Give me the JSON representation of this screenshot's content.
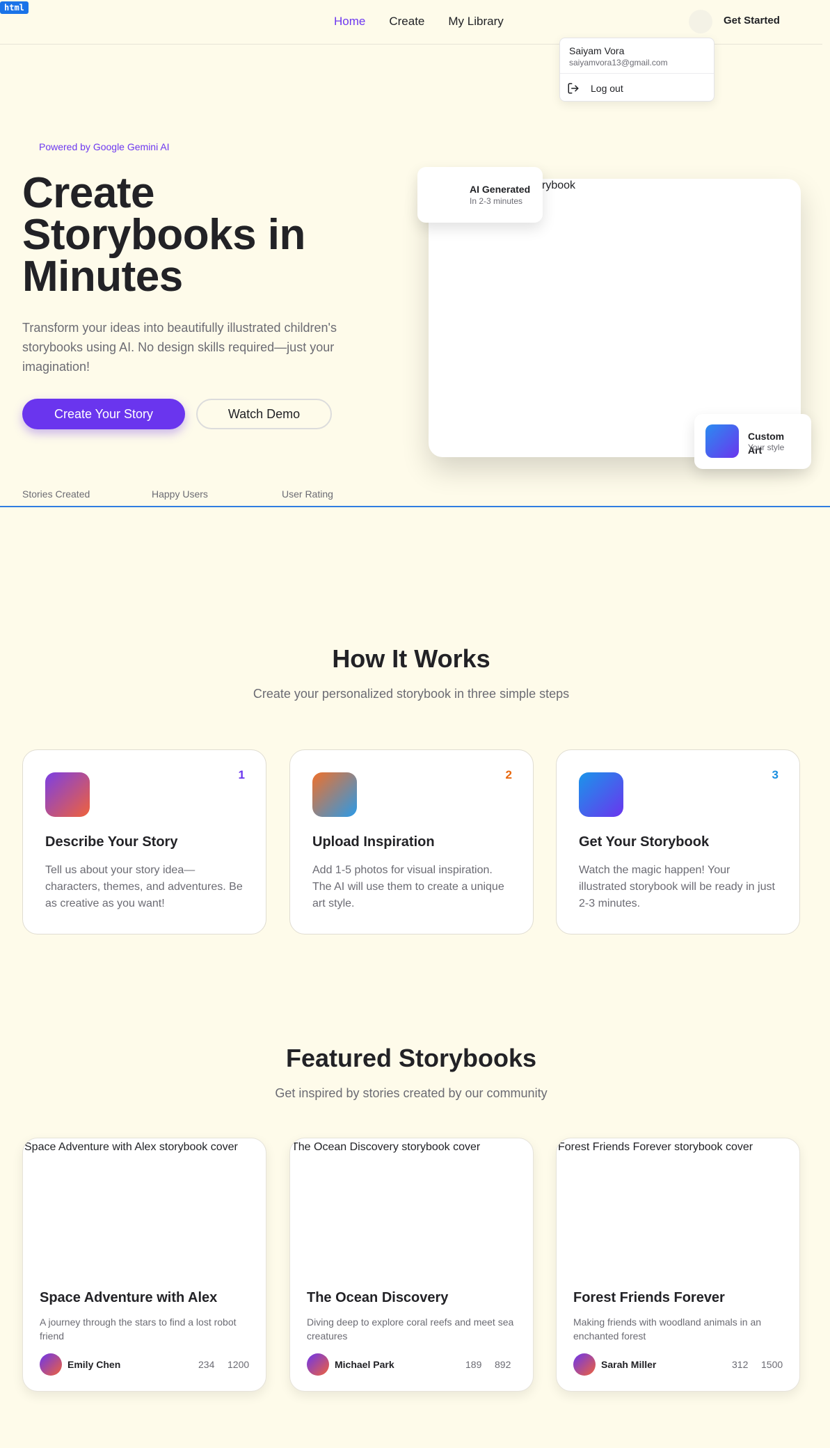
{
  "debug_tag": "html",
  "nav": {
    "items": [
      {
        "label": "Home",
        "active": true
      },
      {
        "label": "Create",
        "active": false
      },
      {
        "label": "My Library",
        "active": false
      }
    ],
    "get_started": "Get Started",
    "accent_color": "#6d38f0"
  },
  "user_menu": {
    "name": "Saiyam Vora",
    "email": "saiyamvora13@gmail.com",
    "logout": "Log out",
    "logout_icon": "logout-icon"
  },
  "hero": {
    "powered_by": "Powered by Google Gemini AI",
    "title": "Create Storybooks in Minutes",
    "description": "Transform your ideas into beautifully illustrated children's storybooks using AI. No design skills required—just your imagination!",
    "primary_cta": "Create Your Story",
    "secondary_cta": "Watch Demo",
    "preview_alt": "rybook",
    "badge_ai_title": "AI Generated",
    "badge_ai_sub": "In 2-3 minutes",
    "badge_art_title": "Custom Art",
    "badge_art_sub": "Your style",
    "stats": [
      "Stories Created",
      "Happy Users",
      "User Rating"
    ]
  },
  "how_it_works": {
    "title": "How It Works",
    "subtitle": "Create your personalized storybook in three simple steps",
    "steps": [
      {
        "number": "1",
        "title": "Describe Your Story",
        "desc": "Tell us about your story idea—characters, themes, and adventures. Be as creative as you want!",
        "color": "#6a35ee",
        "gradient": [
          "#7b3fe4",
          "#f0623a"
        ]
      },
      {
        "number": "2",
        "title": "Upload Inspiration",
        "desc": "Add 1-5 photos for visual inspiration. The AI will use them to create a unique art style.",
        "color": "#e8680f",
        "gradient": [
          "#f0702a",
          "#2a9ae8"
        ]
      },
      {
        "number": "3",
        "title": "Get Your Storybook",
        "desc": "Watch the magic happen! Your illustrated storybook will be ready in just 2-3 minutes.",
        "color": "#1a8fe0",
        "gradient": [
          "#1a95ea",
          "#6a35ee"
        ]
      }
    ]
  },
  "featured": {
    "title": "Featured Storybooks",
    "subtitle": "Get inspired by stories created by our community",
    "stories": [
      {
        "cover_alt": "Space Adventure with Alex storybook cover",
        "title": "Space Adventure with Alex",
        "desc": "A journey through the stars to find a lost robot friend",
        "author": "Emily Chen",
        "views": "234",
        "likes": "1200"
      },
      {
        "cover_alt": "The Ocean Discovery storybook cover",
        "title": "The Ocean Discovery",
        "desc": "Diving deep to explore coral reefs and meet sea creatures",
        "author": "Michael Park",
        "views": "189",
        "likes": "892"
      },
      {
        "cover_alt": "Forest Friends Forever storybook cover",
        "title": "Forest Friends Forever",
        "desc": "Making friends with woodland animals in an enchanted forest",
        "author": "Sarah Miller",
        "views": "312",
        "likes": "1500"
      }
    ]
  }
}
